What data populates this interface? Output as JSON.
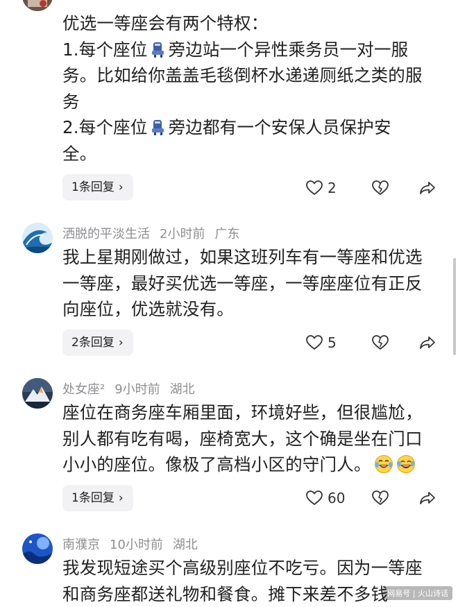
{
  "comments": [
    {
      "username": "",
      "time": "",
      "location": "",
      "body_lines": [
        [
          "优选一等座会有两个特权："
        ],
        [
          "1.每个座位",
          "seat",
          "旁边站一个异性乘务员一对一服"
        ],
        [
          "务。比如给你盖盖毛毯倒杯水递递厕纸之类的服"
        ],
        [
          "务"
        ],
        [
          "2.每个座位",
          "seat",
          "旁边都有一个安保人员保护安"
        ],
        [
          "全。"
        ]
      ],
      "reply_label": "1条回复",
      "likes": "2"
    },
    {
      "username": "洒脱的平淡生活",
      "time": "2小时前",
      "location": "广东",
      "body_lines": [
        [
          "我上星期刚做过，如果这班列车有一等座和优选"
        ],
        [
          "一等座，最好买优选一等座，一等座座位有正反"
        ],
        [
          "向座位，优选就没有。"
        ]
      ],
      "reply_label": "2条回复",
      "likes": "5"
    },
    {
      "username": "处女座²",
      "time": "9小时前",
      "location": "湖北",
      "body_lines": [
        [
          "座位在商务座车厢里面，环境好些，但很尴尬，"
        ],
        [
          "别人都有吃有喝，座椅宽大，这个确是坐在门口"
        ],
        [
          "小小的座位。像极了高档小区的守门人。",
          "laugh-cry",
          "laugh-tears"
        ]
      ],
      "reply_label": "1条回复",
      "likes": "60"
    },
    {
      "username": "南濮京",
      "time": "10小时前",
      "location": "湖北",
      "body_lines": [
        [
          "我发现短途买个高级别座位不吃亏。因为一等座"
        ],
        [
          "和商务座都送礼物和餐食。摊下来差不多钱"
        ]
      ]
    }
  ],
  "icons": {
    "chevron": "›",
    "like": "heart-outline-icon",
    "dislike": "broken-heart-icon",
    "share": "share-arrow-icon"
  },
  "watermark": "网易号 | 火山诗话",
  "colors": {
    "text": "#1f1f1f",
    "meta": "#8e8e93",
    "reply_bg": "#f2f2f4"
  }
}
